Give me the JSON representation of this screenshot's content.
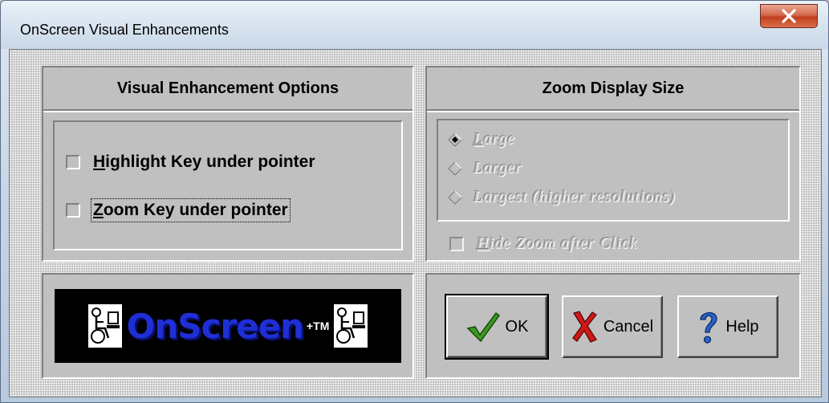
{
  "window": {
    "title": "OnScreen Visual Enhancements",
    "close_label": "x"
  },
  "visual_options": {
    "header": "Visual Enhancement Options",
    "checkboxes": [
      {
        "accel": "H",
        "rest": "ighlight Key under pointer",
        "checked": false
      },
      {
        "accel": "Z",
        "rest": "oom Key under pointer",
        "checked": false
      }
    ]
  },
  "zoom": {
    "header": "Zoom Display Size",
    "options": [
      {
        "accel": "L",
        "rest": "arge",
        "selected": true
      },
      {
        "accel": "",
        "rest": "Larger",
        "selected": false
      },
      {
        "accel": "",
        "rest": "Largest (higher resolutions)",
        "selected": false
      }
    ],
    "hide_zoom": {
      "accel": "H",
      "rest": "ide Zoom after Click",
      "checked": false
    }
  },
  "logo": {
    "text": "OnScreen",
    "tm": "+TM"
  },
  "buttons": {
    "ok": "OK",
    "cancel": "Cancel",
    "help": "Help"
  },
  "colors": {
    "face": "#c0c0c0",
    "logo_blue": "#1f2fd6",
    "ok_check": "#3a9a1e",
    "cancel_x": "#d01818",
    "help_q": "#2a62c8"
  }
}
